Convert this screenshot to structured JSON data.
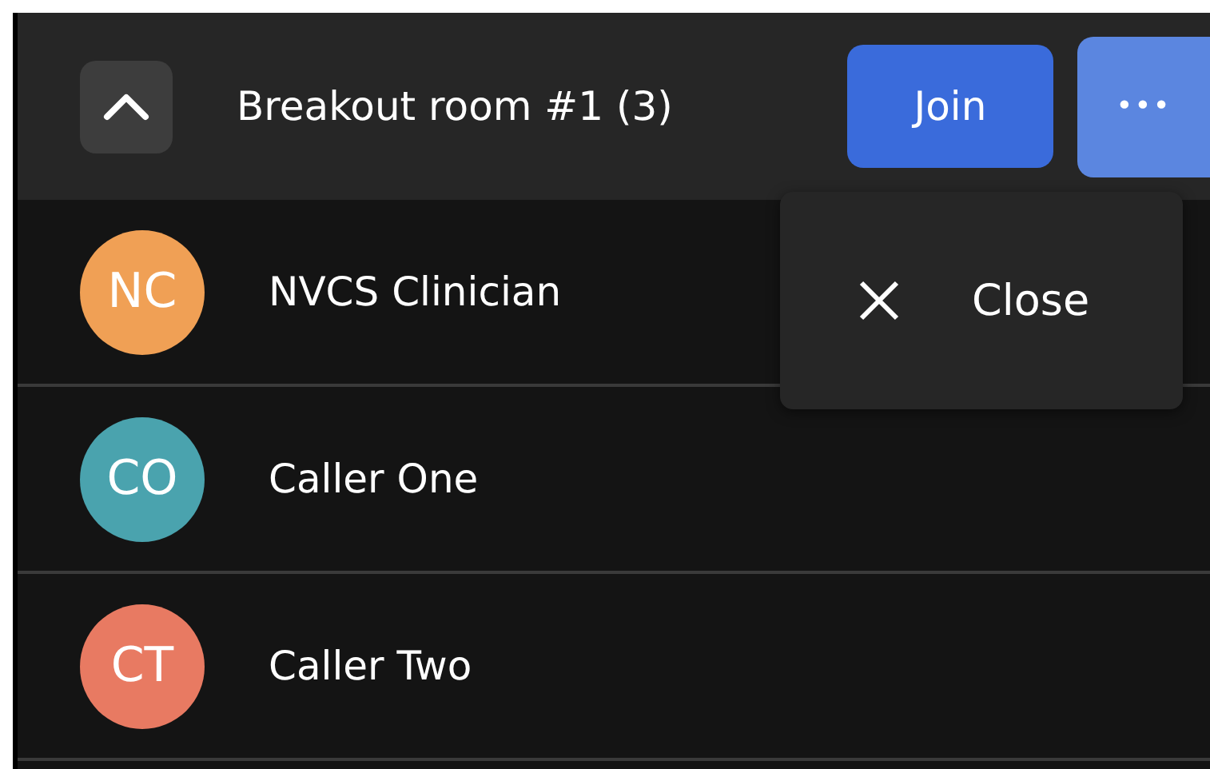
{
  "room": {
    "title": "Breakout room #1 (3)",
    "expanded": true,
    "join_label": "Join",
    "more_label": "•••",
    "menu_open": true
  },
  "menu": {
    "items": [
      {
        "label": "Close",
        "kind": "close"
      }
    ]
  },
  "participants": [
    {
      "initials": "NC",
      "name": "NVCS Clinician",
      "color": "#f0a055"
    },
    {
      "initials": "CO",
      "name": "Caller One",
      "color": "#4aa3ae"
    },
    {
      "initials": "CT",
      "name": "Caller Two",
      "color": "#e87a62"
    }
  ]
}
